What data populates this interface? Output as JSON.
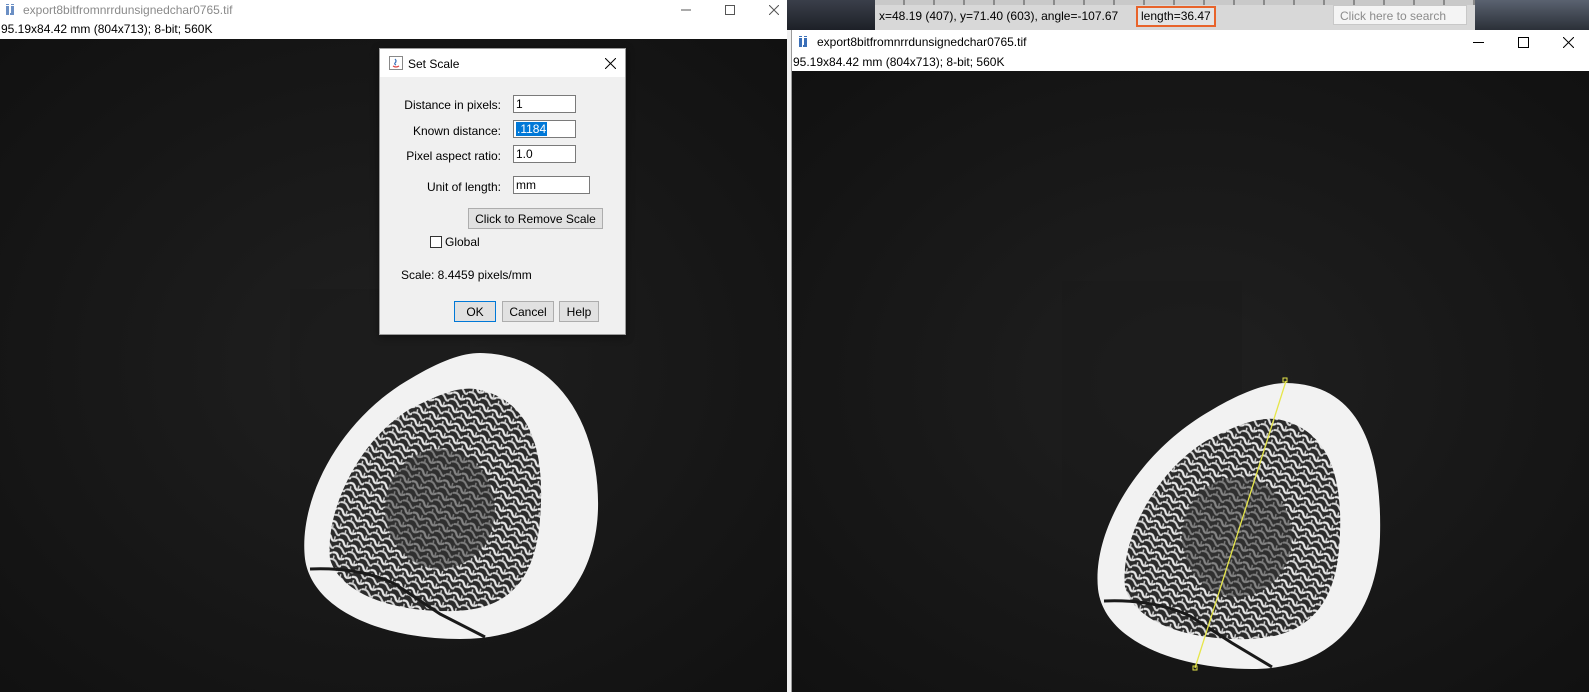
{
  "left_window": {
    "title": "export8bitfromnrrdunsignedchar0765.tif",
    "info": "95.19x84.42 mm (804x713); 8-bit; 560K"
  },
  "right_window": {
    "title": "export8bitfromnrrdunsignedchar0765.tif",
    "info": "95.19x84.42 mm (804x713); 8-bit; 560K"
  },
  "status_bar": {
    "text": "x=48.19 (407), y=71.40 (603), angle=-107.67",
    "length": "length=36.47",
    "search_placeholder": "Click here to search",
    "highlight_color": "#e8632a"
  },
  "dialog": {
    "title": "Set Scale",
    "fields": [
      {
        "label": "Distance in pixels:",
        "value": "1"
      },
      {
        "label": "Known distance:",
        "value": ".1184"
      },
      {
        "label": "Pixel aspect ratio:",
        "value": "1.0"
      },
      {
        "label": "Unit of length:",
        "value": "mm"
      }
    ],
    "remove_scale_label": "Click to Remove Scale",
    "global_label": "Global",
    "global_checked": false,
    "scale_text": "Scale: 8.4459 pixels/mm",
    "ok_label": "OK",
    "cancel_label": "Cancel",
    "help_label": "Help"
  },
  "icons": {
    "imagej": "imagej-icon",
    "minimize": "minimize-icon",
    "maximize": "maximize-icon",
    "close": "close-icon",
    "java": "java-icon"
  },
  "measurement_line_color": "#e6e64a"
}
